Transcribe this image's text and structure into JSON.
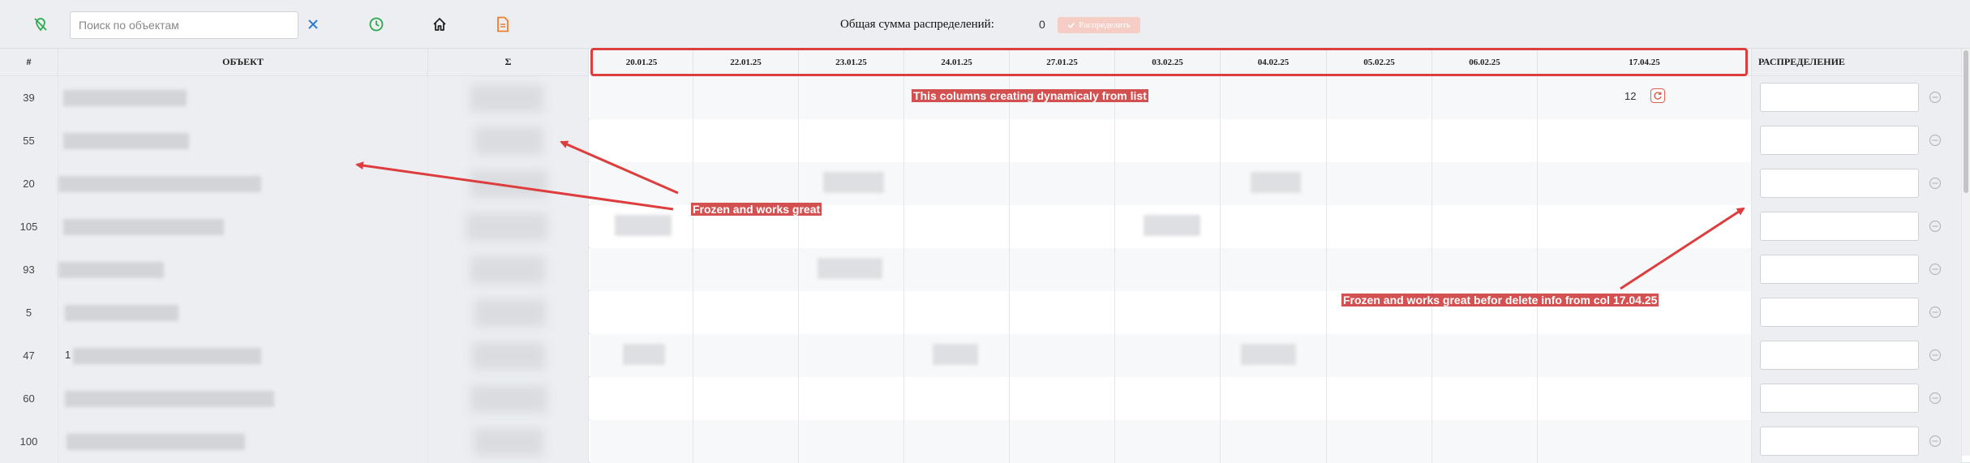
{
  "toolbar": {
    "search_placeholder": "Поиск по объектам",
    "total_label": "Общая сумма распределений:",
    "total_value": "0",
    "distribute_label": "Распределить"
  },
  "columns": {
    "num": "#",
    "object": "ОБЪЕКТ",
    "sum": "Σ",
    "dates": [
      "20.01.25",
      "22.01.25",
      "23.01.25",
      "24.01.25",
      "27.01.25",
      "03.02.25",
      "04.02.25",
      "05.02.25",
      "06.02.25",
      "17.04.25"
    ],
    "distribution": "РАСПРЕДЕЛЕНИЕ"
  },
  "rows": [
    {
      "num": "39"
    },
    {
      "num": "55"
    },
    {
      "num": "20"
    },
    {
      "num": "105"
    },
    {
      "num": "93"
    },
    {
      "num": "5"
    },
    {
      "num": "47"
    },
    {
      "num": "60"
    },
    {
      "num": "100"
    }
  ],
  "row_visible_value": "12",
  "row_object_prefix": "1",
  "annotations": {
    "dynamic_columns": "This columns creating dynamicaly from list",
    "frozen_left": "Frozen and works great",
    "frozen_right": "Frozen and works great befor delete info from col 17.04.25"
  },
  "colors": {
    "accent_red": "#de3d3d",
    "icon_green": "#2ea84f",
    "icon_orange": "#f07e2b",
    "clear_blue": "#2f7dd1"
  }
}
